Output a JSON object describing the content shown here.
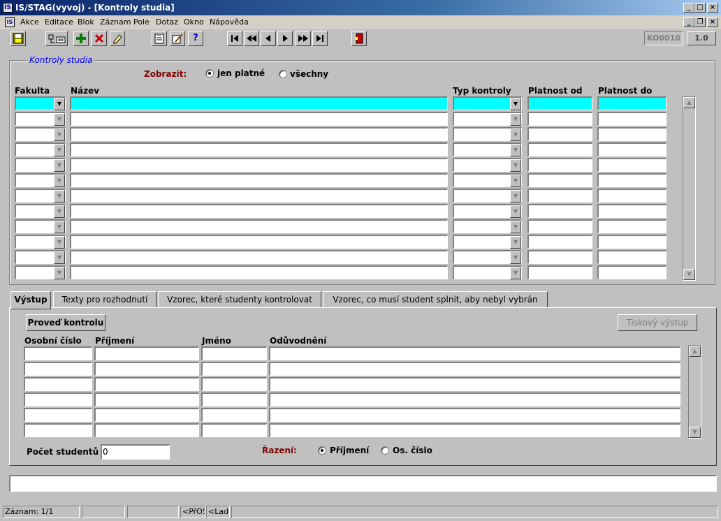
{
  "window": {
    "title": "IS/STAG(vyvoj) - [Kontroly studia]",
    "app_icon_label": "IS",
    "buttons": {
      "minimize": "_",
      "maximize": "□",
      "close": "×"
    }
  },
  "menu": {
    "items": [
      "Akce",
      "Editace",
      "Blok",
      "Záznam",
      "Pole",
      "Dotaz",
      "Okno",
      "Nápověda"
    ],
    "mdi_buttons": {
      "minimize": "_",
      "restore": "❐",
      "close": "×"
    }
  },
  "toolbar": {
    "indicator_code": "KO0010",
    "indicator_version": "1.0",
    "icons": [
      "save-icon",
      "query-icon",
      "insert-record-icon",
      "delete-record-icon",
      "edit-icon",
      "clipboard-icon",
      "pen-icon",
      "help-icon",
      "first-record-icon",
      "previous-block-icon",
      "previous-record-icon",
      "next-record-icon",
      "next-block-icon",
      "last-record-icon",
      "exit-icon"
    ]
  },
  "main": {
    "frame_title": "Kontroly studia",
    "filter": {
      "label": "Zobrazit:",
      "options": [
        "jen platné",
        "všechny"
      ],
      "selected": "jen platné"
    },
    "columns": {
      "fakulta": "Fakulta",
      "nazev": "Název",
      "typ_kontroly": "Typ kontroly",
      "platnost_od": "Platnost od",
      "platnost_do": "Platnost do"
    },
    "row_count": 12
  },
  "tabs": [
    {
      "label": "Výstup",
      "active": true
    },
    {
      "label": "Texty pro rozhodnutí",
      "active": false
    },
    {
      "label": "Vzorec, které studenty kontrolovat",
      "active": false
    },
    {
      "label": "Vzorec, co musí student splnit, aby nebyl vybrán",
      "active": false
    }
  ],
  "output": {
    "run_button": "Proveď kontrolu",
    "print_button": "Tiskový výstup",
    "columns": {
      "osobni_cislo": "Osobní číslo",
      "prijmeni": "Příjmení",
      "jmeno": "Jméno",
      "oduvodneni": "Odůvodnění"
    },
    "row_count": 6,
    "count_label": "Počet studentů",
    "count_value": "0",
    "sort": {
      "label": "Řazení:",
      "options": [
        "Příjmení",
        "Os. číslo"
      ],
      "selected": "Příjmení"
    }
  },
  "statusbar": {
    "record": "Záznam: 1/1",
    "cell_2": "",
    "cell_3": "",
    "mode": "<PřOS",
    "debug": "<Ladě"
  }
}
